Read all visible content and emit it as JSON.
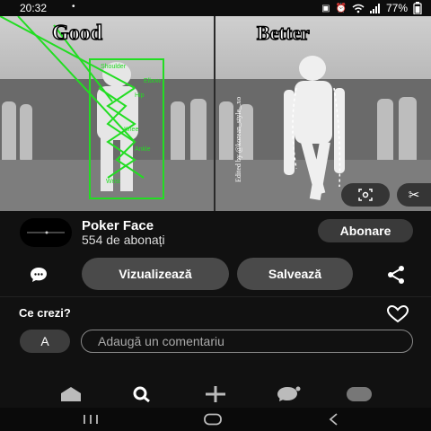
{
  "status_bar": {
    "time": "20:32",
    "battery": "77%",
    "icons": [
      "camera-notification-icon",
      "alarm-icon",
      "wifi-icon",
      "signal-icon",
      "battery-icon"
    ]
  },
  "pin": {
    "left_caption": "Good",
    "right_caption": "Better",
    "watermark": "Edited by @korean_style_.xo",
    "pose_labels": [
      "Shoulder",
      "Elbow",
      "Hip",
      "Knee",
      "Ankle",
      "Wrist"
    ],
    "pose_color": "#22dd22"
  },
  "creator": {
    "name": "Poker Face",
    "followers": "554 de abonați",
    "follow_label": "Abonare"
  },
  "actions": {
    "view_label": "Vizualizează",
    "save_label": "Salvează"
  },
  "comments": {
    "prompt": "Ce crezi?",
    "avatar_letter": "A",
    "placeholder": "Adaugă un comentariu"
  },
  "tabs": [
    "home",
    "search",
    "create",
    "messages",
    "profile"
  ],
  "colors": {
    "background": "#111111",
    "button": "#4a4a4a",
    "accent_green": "#22dd22"
  }
}
